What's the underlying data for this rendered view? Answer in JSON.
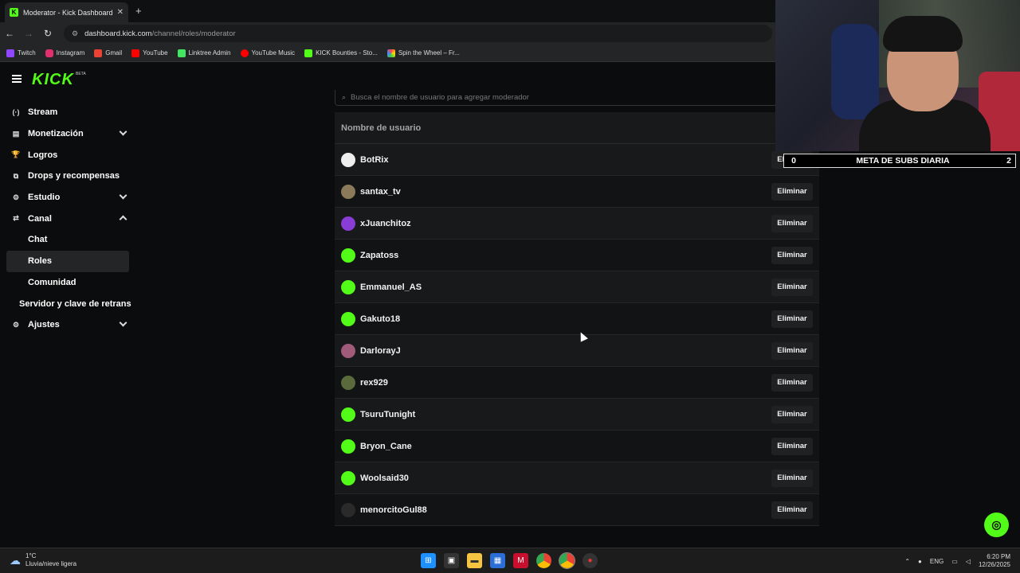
{
  "browser": {
    "tab_title": "Moderator - Kick Dashboard",
    "tab_favicon": "K",
    "close_glyph": "✕",
    "newtab_glyph": "+",
    "url_domain": "dashboard.kick.com",
    "url_path": "/channel/roles/moderator",
    "bookmarks": [
      "Twitch",
      "Instagram",
      "Gmail",
      "YouTube",
      "Linktree Admin",
      "YouTube Music",
      "KICK Bounties - Sto...",
      "Spin the Wheel – Fr..."
    ]
  },
  "brand": {
    "logo": "KICK",
    "badge": "BETA",
    "accent": "#53fc18"
  },
  "sidebar": {
    "items": [
      {
        "label": "Stream",
        "icon": "(·)"
      },
      {
        "label": "Monetización",
        "icon": "▤"
      },
      {
        "label": "Logros",
        "icon": "🏆"
      },
      {
        "label": "Drops y recompensas",
        "icon": "⧉"
      },
      {
        "label": "Estudio",
        "icon": "⚙"
      },
      {
        "label": "Canal",
        "icon": "⇄"
      },
      {
        "label": "Chat"
      },
      {
        "label": "Roles"
      },
      {
        "label": "Comunidad"
      },
      {
        "label": "Servidor y clave de retrans"
      },
      {
        "label": "Ajustes",
        "icon": "⚙"
      }
    ]
  },
  "search": {
    "placeholder": "Busca el nombre de usuario para agregar moderador"
  },
  "table": {
    "header": "Nombre de usuario",
    "remove_label": "Eliminar",
    "rows": [
      {
        "name": "BotRix",
        "avatar_color": "#eeeeee"
      },
      {
        "name": "santax_tv",
        "avatar_color": "#8a7a5a"
      },
      {
        "name": "xJuanchitoz",
        "avatar_color": "#8a3cd6"
      },
      {
        "name": "Zapatoss",
        "avatar_color": "#53fc18"
      },
      {
        "name": "Emmanuel_AS",
        "avatar_color": "#53fc18"
      },
      {
        "name": "Gakuto18",
        "avatar_color": "#53fc18"
      },
      {
        "name": "DarlorayJ",
        "avatar_color": "#a05a7a"
      },
      {
        "name": "rex929",
        "avatar_color": "#5a6a3a"
      },
      {
        "name": "TsuruTunight",
        "avatar_color": "#53fc18"
      },
      {
        "name": "Bryon_Cane",
        "avatar_color": "#53fc18"
      },
      {
        "name": "Woolsaid30",
        "avatar_color": "#53fc18"
      },
      {
        "name": "menorcitoGul88",
        "avatar_color": "#2a2a2a"
      }
    ]
  },
  "overlay": {
    "subs_current": "0",
    "subs_label": "META DE SUBS DIARIA",
    "subs_goal": "2"
  },
  "taskbar": {
    "weather_temp": "1°C",
    "weather_desc": "Lluvia/nieve ligera",
    "lang": "ENG",
    "time": "6:20 PM",
    "date": "12/26/2025"
  }
}
